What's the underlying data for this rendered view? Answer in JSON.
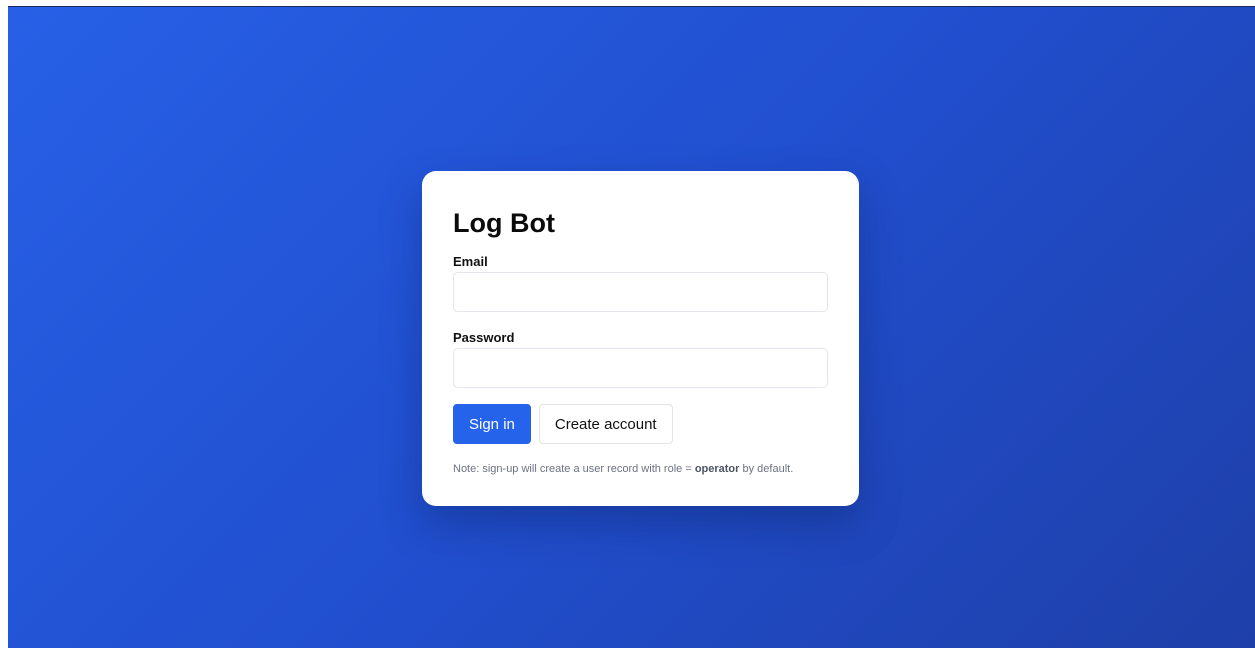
{
  "app": {
    "title": "Log Bot"
  },
  "form": {
    "email_label": "Email",
    "email_value": "",
    "email_placeholder": "",
    "password_label": "Password",
    "password_value": "",
    "password_placeholder": "",
    "signin_label": "Sign in",
    "create_label": "Create account"
  },
  "note": {
    "prefix": "Note: sign-up will create a user record with role = ",
    "role": "operator",
    "suffix": " by default."
  },
  "colors": {
    "accent": "#2563eb",
    "background_start": "#2760e6",
    "background_end": "#1e3fa8"
  }
}
